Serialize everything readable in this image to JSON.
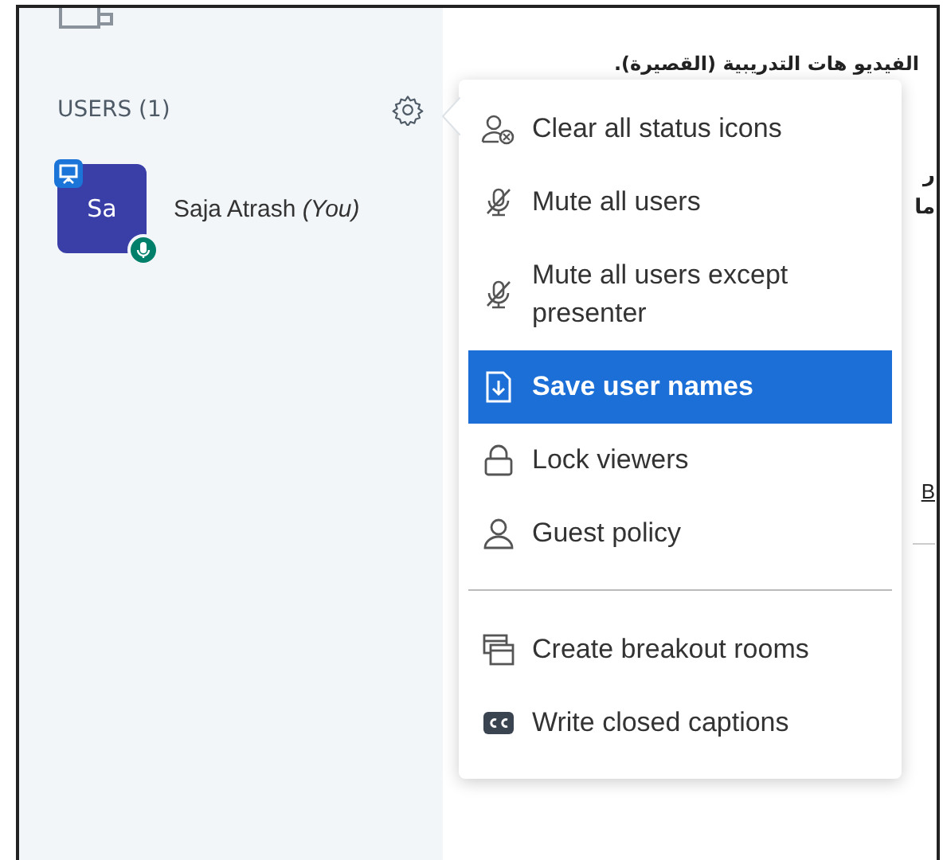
{
  "sidebar": {
    "users_heading": "USERS (1)",
    "users": [
      {
        "initials": "Sa",
        "name": "Saja Atrash *(You)*",
        "presenter": true,
        "mic_on": true
      }
    ]
  },
  "content": {
    "heading": "الفيديو هات التدريبية (القصيرة).",
    "fragments": [
      "ر",
      "ما"
    ],
    "link_fragment": "B"
  },
  "menu": {
    "groups": [
      [
        {
          "label": "Clear all status icons",
          "selected": false
        },
        {
          "label": "Mute all users",
          "selected": false
        },
        {
          "label": "Mute all users except presenter",
          "selected": false
        },
        {
          "label": "Save user names",
          "selected": true
        },
        {
          "label": "Lock viewers",
          "selected": false
        },
        {
          "label": "Guest policy",
          "selected": false
        }
      ],
      [
        {
          "label": "Create breakout rooms",
          "selected": false
        },
        {
          "label": "Write closed captions",
          "selected": false
        }
      ]
    ]
  }
}
